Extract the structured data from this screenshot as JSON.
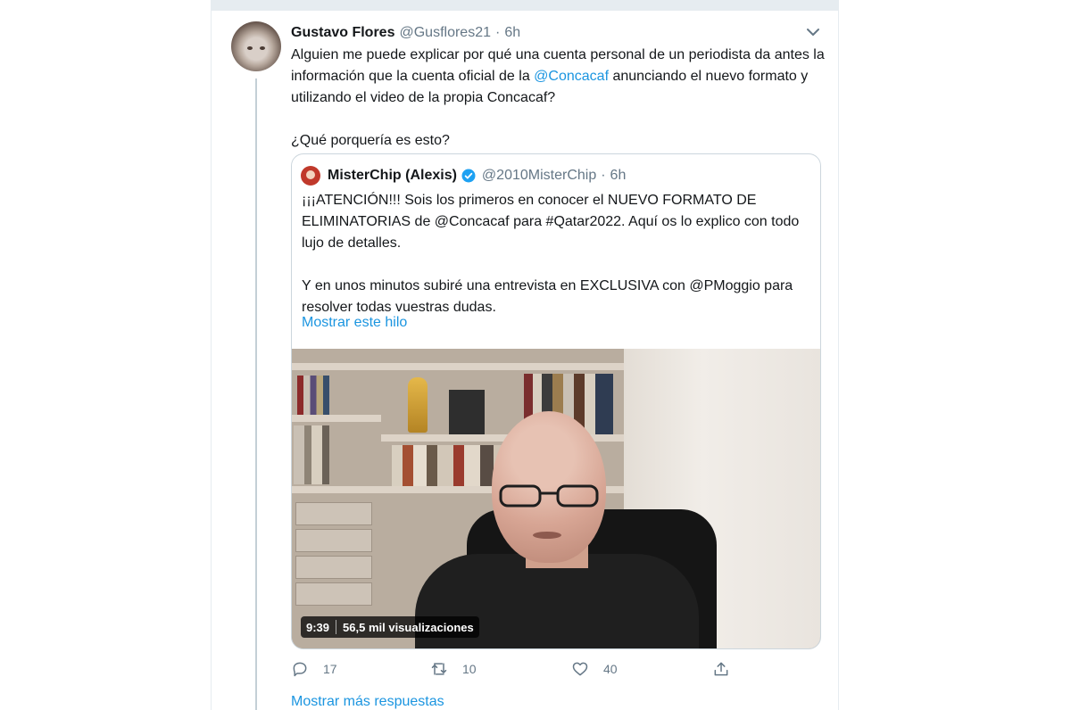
{
  "tweet": {
    "author_name": "Gustavo Flores",
    "author_handle": "@Gusflores21",
    "separator": "·",
    "time": "6h",
    "text_part1": "Alguien me puede explicar por qué una cuenta personal de un periodista da antes la información que la cuenta oficial de la ",
    "mention": "@Concacaf",
    "text_part2": " anunciando el nuevo formato y utilizando el video de la propia Concacaf?",
    "text_para2": "¿Qué porquería es esto?",
    "reply_count": "17",
    "retweet_count": "10",
    "like_count": "40"
  },
  "quoted": {
    "author_name": "MisterChip (Alexis)",
    "author_handle": "@2010MisterChip",
    "separator": "·",
    "time": "6h",
    "text_para1": "¡¡¡ATENCIÓN!!! Sois los primeros en conocer el NUEVO FORMATO DE ELIMINATORIAS de @Concacaf para #Qatar2022. Aquí os lo explico con todo lujo de detalles.",
    "text_para2": "Y en unos minutos subiré una entrevista en EXCLUSIVA con @PMoggio para resolver todas vuestras dudas.",
    "show_thread": "Mostrar este hilo",
    "video_duration": "9:39",
    "video_views": "56,5 mil visualizaciones"
  },
  "more_replies": "Mostrar más respuestas",
  "icons": {
    "caret": "chevron-down-icon",
    "verified": "verified-badge-icon",
    "reply": "reply-icon",
    "retweet": "retweet-icon",
    "like": "heart-icon",
    "share": "share-icon"
  },
  "colors": {
    "link": "#1b95e0",
    "secondary_text": "#657786",
    "primary_text": "#14171a",
    "border": "#ccd6dd",
    "verified": "#1da1f2"
  }
}
